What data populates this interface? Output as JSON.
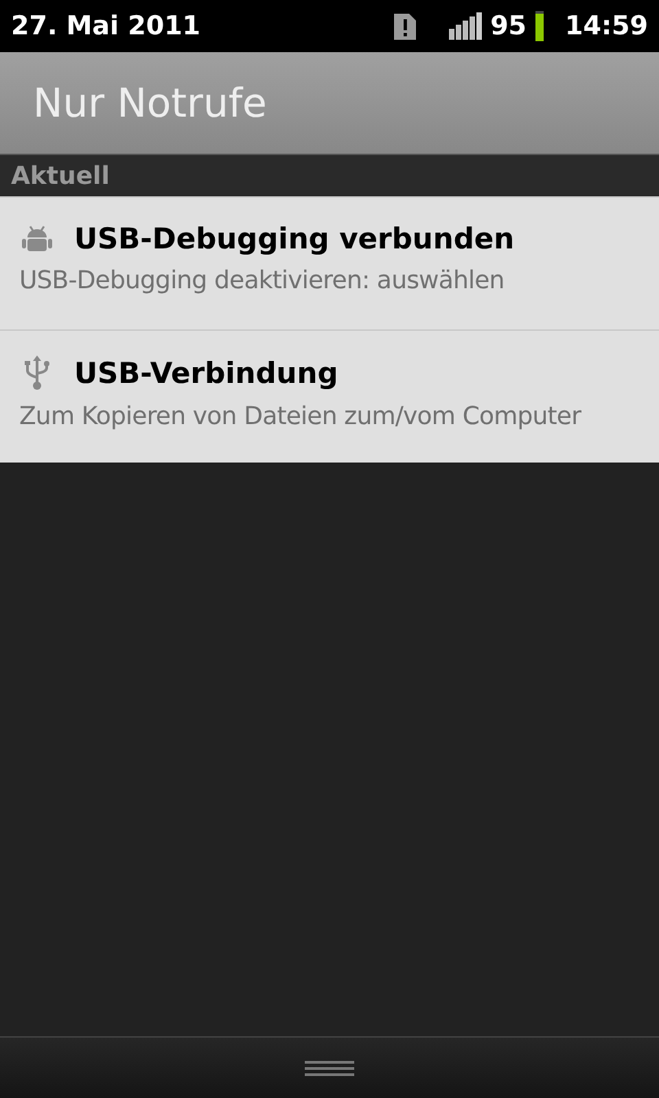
{
  "status_bar": {
    "date": "27. Mai 2011",
    "battery": "95",
    "time": "14:59"
  },
  "header": {
    "title": "Nur Notrufe"
  },
  "section": {
    "title": "Aktuell"
  },
  "notifications": [
    {
      "kind": "debug",
      "title": "USB-Debugging verbunden",
      "text": "USB-Debugging deaktivieren: auswählen"
    },
    {
      "kind": "usb",
      "title": "USB-Verbindung",
      "text": "Zum Kopieren von Dateien zum/vom Computer"
    }
  ]
}
